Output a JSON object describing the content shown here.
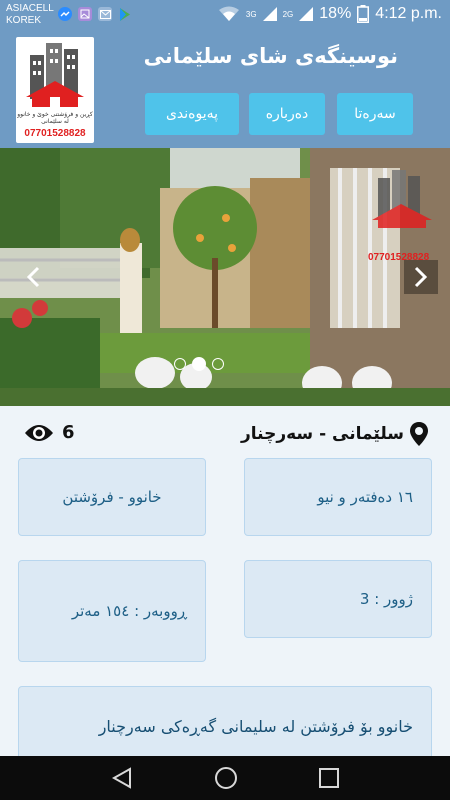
{
  "status_bar": {
    "carrier_line1": "ASIACELL",
    "carrier_line2": "KOREK",
    "network_1": "3G",
    "network_2": "2G",
    "battery": "18%",
    "time": "4:12 p.m."
  },
  "header": {
    "title": "نوسینگەی شای سلێمانی",
    "logo_text": "کڕین و فرۆشتنی خوێ و خانوو لە سلێمانی",
    "logo_phone": "07701528828",
    "nav": {
      "home": "سەرەتا",
      "about": "دەربارە",
      "contact": "پەیوەندی"
    }
  },
  "carousel": {
    "slide_count": 3,
    "active_slide": 2,
    "watermark_phone": "07701528828"
  },
  "listing": {
    "views": "6",
    "location": "سلێمانی - سەرچنار",
    "plot_size": "١٦ دەفتەر و نیو",
    "deal_type": "خانوو - فرۆشتن",
    "rooms": "ژوور : 3",
    "area": "ڕووبەر : ١٥٤ مەتر",
    "description": "خانوو بۆ فرۆشتن لە سلیمانی گەڕەکی سەرچنار"
  },
  "colors": {
    "header_bg": "#6f9bc4",
    "nav_button": "#4fc3ea",
    "card_bg": "#dce9f4",
    "card_text": "#1d5f86"
  }
}
